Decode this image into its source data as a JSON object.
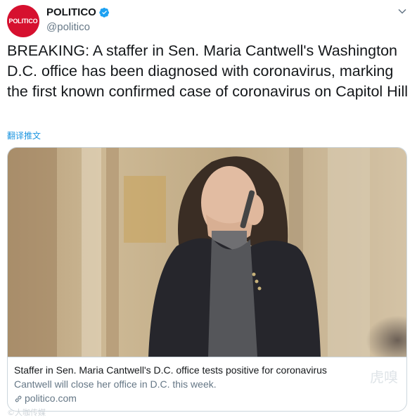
{
  "header": {
    "avatar_text": "POLITICO",
    "display_name": "POLITICO",
    "handle": "@politico",
    "verified_icon": "verified-badge-icon",
    "menu_icon": "chevron-down-icon"
  },
  "tweet": {
    "text": "BREAKING: A staffer in Sen. Maria Cantwell's Washington D.C. office has been diagnosed with coronavirus, marking the first known confirmed case of coronavirus on Capitol Hill",
    "translate_label": "翻译推文"
  },
  "card": {
    "image_alt": "Sen. Maria Cantwell on phone",
    "title": "Staffer in Sen. Maria Cantwell's D.C. office tests positive for coronavirus",
    "description": "Cantwell will close her office in D.C. this week.",
    "domain": "politico.com",
    "link_icon": "link-icon"
  },
  "watermarks": {
    "left": "©大咖传媒",
    "right": "虎嗅"
  },
  "colors": {
    "brand_red": "#d6102f",
    "link_blue": "#1b95e0",
    "muted": "#657786"
  }
}
